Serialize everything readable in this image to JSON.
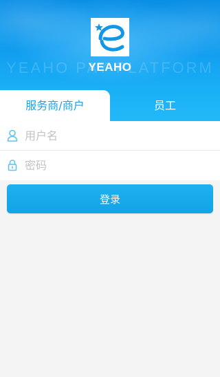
{
  "header": {
    "slogan": "YEAHO PAY PLATFORM",
    "logo_text": "YEAHO",
    "logo_icon": "yeaho-e-logo",
    "colors": {
      "banner": "#129ff0",
      "accent": "#1aa3e8"
    }
  },
  "tabs": [
    {
      "label": "服务商/商户",
      "active": true
    },
    {
      "label": "员工",
      "active": false
    }
  ],
  "form": {
    "username": {
      "placeholder": "用户名",
      "value": "",
      "icon": "user-icon"
    },
    "password": {
      "placeholder": "密码",
      "value": "",
      "icon": "lock-icon"
    }
  },
  "login": {
    "label": "登录"
  }
}
